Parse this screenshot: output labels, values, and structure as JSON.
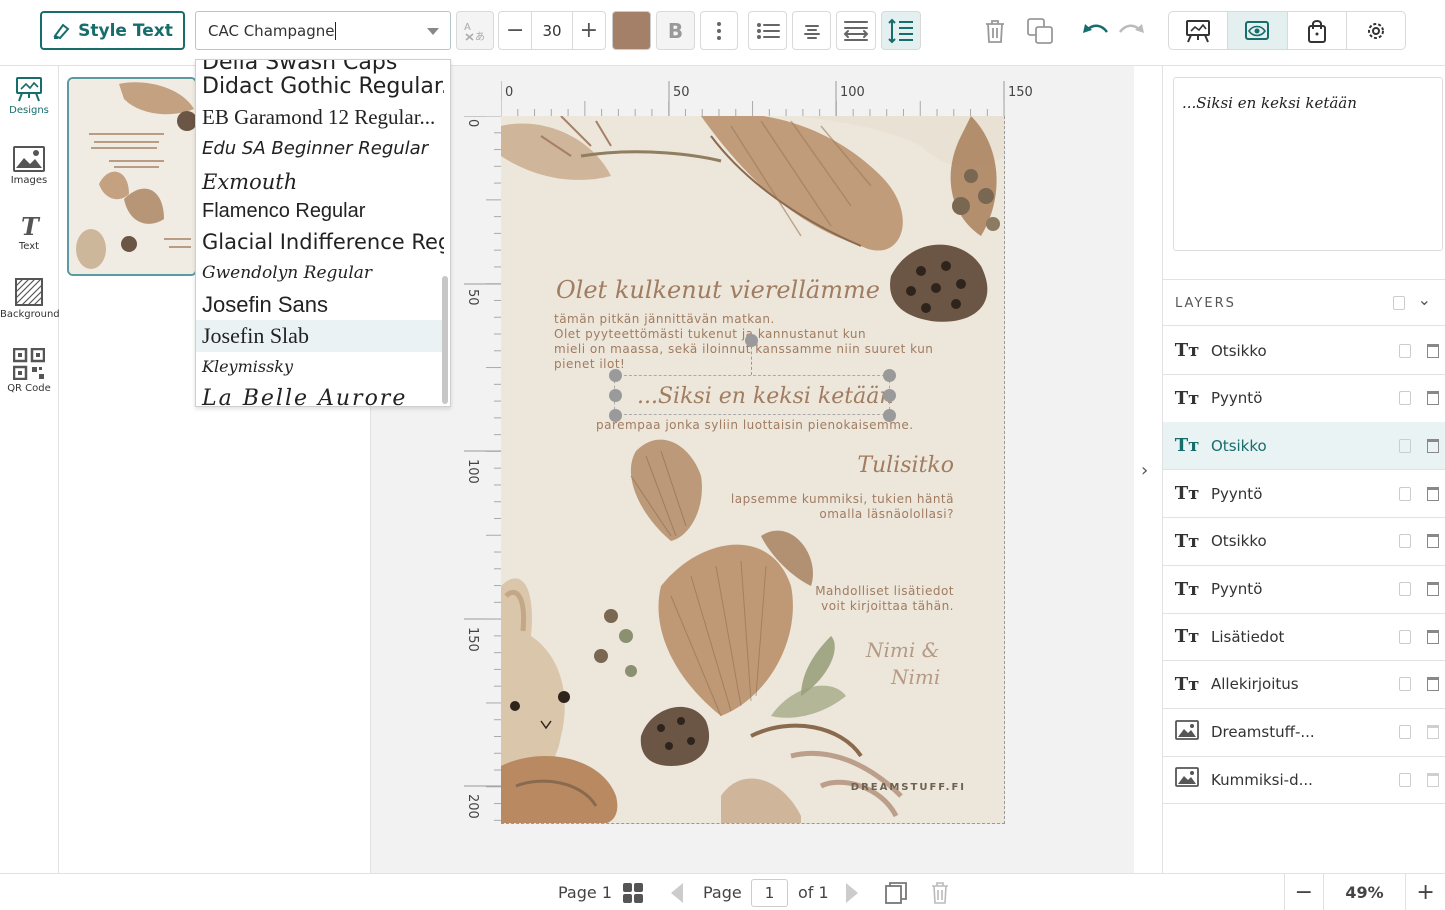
{
  "toolbar": {
    "style_text_label": "Style Text",
    "font_value": "CAC Champagne",
    "font_size": "30",
    "text_color": "#a58068",
    "bold_label": "B"
  },
  "font_options": [
    "Didact Gothic Regular...",
    "EB Garamond 12 Regular...",
    "Edu SA Beginner Regular",
    "Exmouth",
    "Flamenco Regular",
    "Glacial Indifference Reg",
    "Gwendolyn Regular",
    "Josefin Sans",
    "Josefin Slab",
    "Kleymissky",
    "La Belle Aurore"
  ],
  "font_options_partial": "Della Swash Caps",
  "leftnav": {
    "designs": "Designs",
    "images": "Images",
    "text": "Text",
    "background": "Background",
    "qr": "QR Code"
  },
  "ruler": {
    "h": [
      "0",
      "50",
      "100",
      "150"
    ],
    "v": [
      "0",
      "50",
      "100",
      "150",
      "200"
    ]
  },
  "card": {
    "heading1": "Olet kulkenut vierellämme",
    "body1": "tämän pitkän jännittävän matkan.",
    "body2": "Olet pyyteettömästi tukenut ja kannustanut kun",
    "body3": "mieli on maassa, sekä iloinnut kanssamme niin suuret kun",
    "body4": "pienet ilot!",
    "heading2": "...Siksi en keksi ketään",
    "body5": "parempaa jonka syliin luottaisin pienokaisemme.",
    "heading3": "Tulisitko",
    "body6": "lapsemme kummiksi, tukien häntä",
    "body7": "omalla läsnäolollasi?",
    "info1": "Mahdolliset lisätiedot",
    "info2": "voit kirjoittaa tähän.",
    "sig1": "Nimi &",
    "sig2": "Nimi",
    "brand": "DREAMSTUFF.FI"
  },
  "preview_text": "...Siksi en keksi ketään",
  "layers_title": "LAYERS",
  "layers": [
    {
      "name": "Otsikko",
      "type": "text"
    },
    {
      "name": "Pyyntö",
      "type": "text"
    },
    {
      "name": "Otsikko",
      "type": "text"
    },
    {
      "name": "Pyyntö",
      "type": "text"
    },
    {
      "name": "Otsikko",
      "type": "text"
    },
    {
      "name": "Pyyntö",
      "type": "text"
    },
    {
      "name": "Lisätiedot",
      "type": "text"
    },
    {
      "name": "Allekirjoitus",
      "type": "text"
    },
    {
      "name": "Dreamstuff-...",
      "type": "image"
    },
    {
      "name": "Kummiksi-d...",
      "type": "image"
    }
  ],
  "bottom": {
    "page_label": "Page 1",
    "page_word": "Page",
    "page_num": "1",
    "of_label": "of 1",
    "zoom": "49%"
  }
}
